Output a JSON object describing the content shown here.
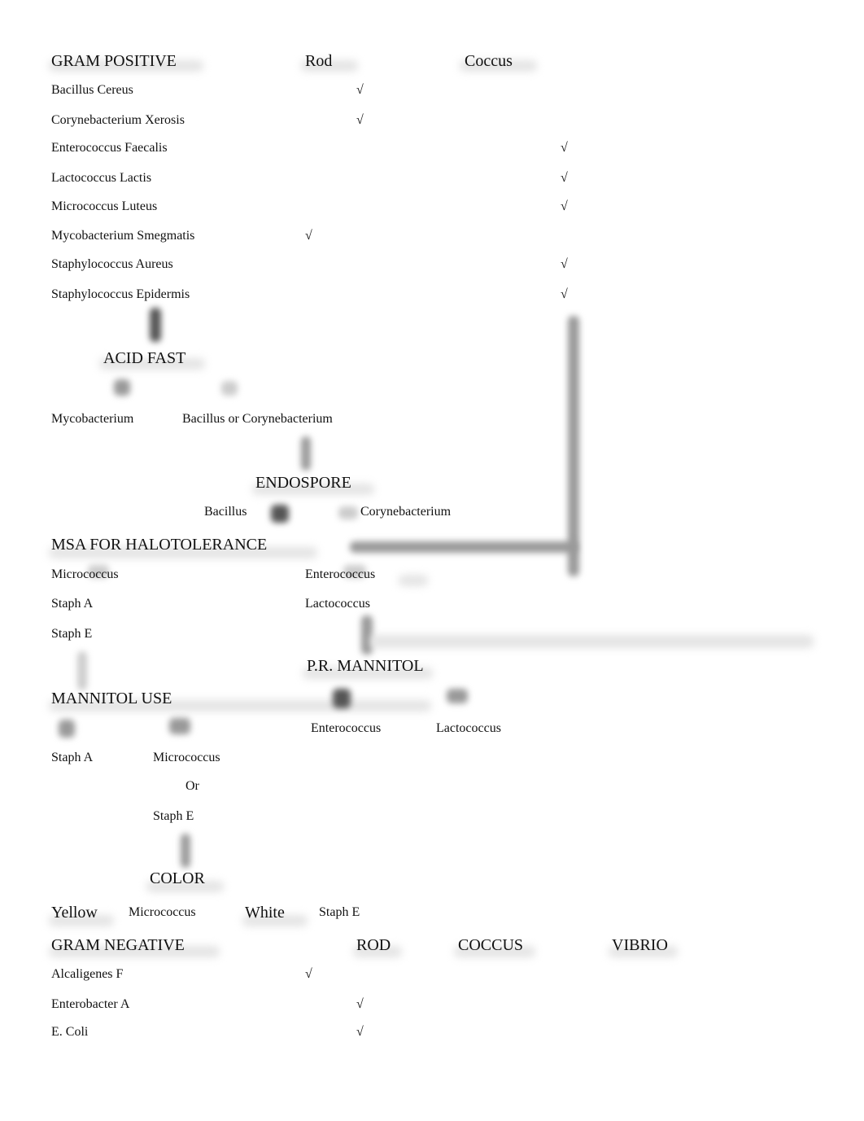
{
  "gram_positive": {
    "title": "GRAM POSITIVE",
    "columns": [
      "Rod",
      "Coccus"
    ],
    "check": "√",
    "rows": [
      {
        "name": "Bacillus Cereus"
      },
      {
        "name": "Corynebacterium Xerosis"
      },
      {
        "name": "Enterococcus Faecalis"
      },
      {
        "name": "Lactococcus Lactis"
      },
      {
        "name": "Micrococcus Luteus"
      },
      {
        "name": "Mycobacterium Smegmatis"
      },
      {
        "name": "Staphylococcus Aureus"
      },
      {
        "name": "Staphylococcus Epidermis"
      }
    ]
  },
  "acid_fast": {
    "title": "ACID FAST",
    "left": "Mycobacterium",
    "right": "Bacillus or Corynebacterium"
  },
  "endospore": {
    "title": "ENDOSPORE",
    "left": "Bacillus",
    "right": "Corynebacterium"
  },
  "msa": {
    "title": "MSA FOR HALOTOLERANCE",
    "left": [
      "Micrococcus",
      "Staph A",
      "Staph E"
    ],
    "right": [
      "Enterococcus",
      "Lactococcus"
    ]
  },
  "pr_mannitol": {
    "title": "P.R. MANNITOL",
    "left": "Enterococcus",
    "right": "Lactococcus"
  },
  "mannitol_use": {
    "title": "MANNITOL USE",
    "left": "Staph A",
    "right": [
      "Micrococcus",
      "Or",
      "Staph E"
    ]
  },
  "color": {
    "title": "COLOR",
    "yellow_label": "Yellow",
    "yellow_value": "Micrococcus",
    "white_label": "White",
    "white_value": "Staph E"
  },
  "gram_negative": {
    "title": "GRAM NEGATIVE",
    "columns": [
      "ROD",
      "COCCUS",
      "VIBRIO"
    ],
    "check": "√",
    "rows": [
      {
        "name": "Alcaligenes F"
      },
      {
        "name": "Enterobacter A"
      },
      {
        "name": "E. Coli"
      }
    ]
  }
}
